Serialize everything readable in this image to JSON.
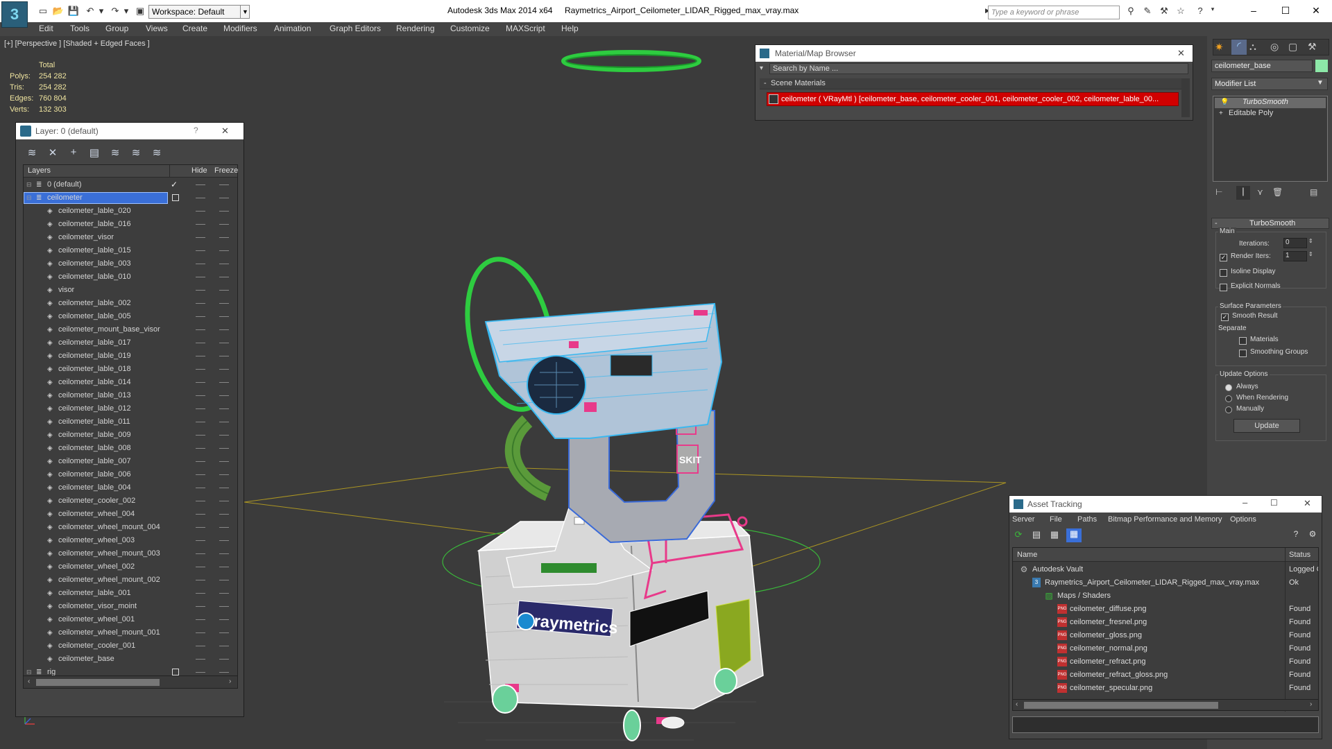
{
  "app": {
    "title": "Autodesk 3ds Max  2014 x64",
    "file": "Raymetrics_Airport_Ceilometer_LIDAR_Rigged_max_vray.max",
    "workspace": "Workspace: Default",
    "search_placeholder": "Type a keyword or phrase",
    "logo": "3"
  },
  "menu": [
    "Edit",
    "Tools",
    "Group",
    "Views",
    "Create",
    "Modifiers",
    "Animation",
    "Graph Editors",
    "Rendering",
    "Customize",
    "MAXScript",
    "Help"
  ],
  "viewport": {
    "label": "[+] [Perspective ] [Shaded + Edged Faces ]",
    "stats": {
      "header": "Total",
      "rows": [
        {
          "label": "Polys:",
          "value": "254 282"
        },
        {
          "label": "Tris:",
          "value": "254 282"
        },
        {
          "label": "Edges:",
          "value": "760 804"
        },
        {
          "label": "Verts:",
          "value": "132 303"
        }
      ]
    },
    "logo_text": "raymetrics",
    "label_sticker": "SKIT"
  },
  "layer_explorer": {
    "title": "Layer: 0 (default)",
    "help": "?",
    "close": "✕",
    "columns": {
      "layers": "Layers",
      "hide": "Hide",
      "freeze": "Freeze"
    },
    "rows": [
      {
        "name": "0 (default)",
        "level": 0,
        "check": "✓"
      },
      {
        "name": "ceilometer",
        "level": 0,
        "selected": true
      },
      {
        "name": "ceilometer_lable_020",
        "level": 1
      },
      {
        "name": "ceilometer_lable_016",
        "level": 1
      },
      {
        "name": "ceilometer_visor",
        "level": 1
      },
      {
        "name": "ceilometer_lable_015",
        "level": 1
      },
      {
        "name": "ceilometer_lable_003",
        "level": 1
      },
      {
        "name": "ceilometer_lable_010",
        "level": 1
      },
      {
        "name": "visor",
        "level": 1
      },
      {
        "name": "ceilometer_lable_002",
        "level": 1
      },
      {
        "name": "ceilometer_lable_005",
        "level": 1
      },
      {
        "name": "ceilometer_mount_base_visor",
        "level": 1
      },
      {
        "name": "ceilometer_lable_017",
        "level": 1
      },
      {
        "name": "ceilometer_lable_019",
        "level": 1
      },
      {
        "name": "ceilometer_lable_018",
        "level": 1
      },
      {
        "name": "ceilometer_lable_014",
        "level": 1
      },
      {
        "name": "ceilometer_lable_013",
        "level": 1
      },
      {
        "name": "ceilometer_lable_012",
        "level": 1
      },
      {
        "name": "ceilometer_lable_011",
        "level": 1
      },
      {
        "name": "ceilometer_lable_009",
        "level": 1
      },
      {
        "name": "ceilometer_lable_008",
        "level": 1
      },
      {
        "name": "ceilometer_lable_007",
        "level": 1
      },
      {
        "name": "ceilometer_lable_006",
        "level": 1
      },
      {
        "name": "ceilometer_lable_004",
        "level": 1
      },
      {
        "name": "ceilometer_cooler_002",
        "level": 1
      },
      {
        "name": "ceilometer_wheel_004",
        "level": 1
      },
      {
        "name": "ceilometer_wheel_mount_004",
        "level": 1
      },
      {
        "name": "ceilometer_wheel_003",
        "level": 1
      },
      {
        "name": "ceilometer_wheel_mount_003",
        "level": 1
      },
      {
        "name": "ceilometer_wheel_002",
        "level": 1
      },
      {
        "name": "ceilometer_wheel_mount_002",
        "level": 1
      },
      {
        "name": "ceilometer_lable_001",
        "level": 1
      },
      {
        "name": "ceilometer_visor_moint",
        "level": 1
      },
      {
        "name": "ceilometer_wheel_001",
        "level": 1
      },
      {
        "name": "ceilometer_wheel_mount_001",
        "level": 1
      },
      {
        "name": "ceilometer_cooler_001",
        "level": 1
      },
      {
        "name": "ceilometer_base",
        "level": 1
      },
      {
        "name": "rig",
        "level": 0
      }
    ]
  },
  "material_browser": {
    "title": "Material/Map Browser",
    "close": "✕",
    "search_placeholder": "Search by Name ...",
    "section": "Scene Materials",
    "section_toggle": "-",
    "item": "ceilometer  ( VRayMtl )  [ceilometer_base, ceilometer_cooler_001, ceilometer_cooler_002, ceilometer_lable_00..."
  },
  "command_panel": {
    "object_name": "ceilometer_base",
    "modifier_list": "Modifier List",
    "stack": [
      "TurboSmooth",
      "Editable Poly"
    ],
    "rollout_title": "TurboSmooth",
    "rollout_toggle": "-",
    "main_group": "Main",
    "iterations_label": "Iterations:",
    "iterations_value": "0",
    "render_iters_label": "Render Iters:",
    "render_iters_value": "1",
    "isoline_display": "Isoline Display",
    "explicit_normals": "Explicit Normals",
    "surface_params": "Surface Parameters",
    "smooth_result": "Smooth Result",
    "separate": "Separate",
    "materials": "Materials",
    "smoothing_groups": "Smoothing Groups",
    "update_options": "Update Options",
    "always": "Always",
    "when_rendering": "When Rendering",
    "manually": "Manually",
    "update_button": "Update",
    "check_mark": "✓"
  },
  "asset_tracking": {
    "title": "Asset Tracking",
    "menu": [
      "Server",
      "File",
      "Paths",
      "Bitmap Performance and Memory",
      "Options"
    ],
    "columns": {
      "name": "Name",
      "status": "Status"
    },
    "rows": [
      {
        "name": "Autodesk Vault",
        "status": "Logged C",
        "level": 0,
        "icon": "vault"
      },
      {
        "name": "Raymetrics_Airport_Ceilometer_LIDAR_Rigged_max_vray.max",
        "status": "Ok",
        "level": 1,
        "icon": "max"
      },
      {
        "name": "Maps / Shaders",
        "status": "",
        "level": 2,
        "icon": "maps"
      },
      {
        "name": "ceilometer_diffuse.png",
        "status": "Found",
        "level": 3,
        "icon": "png"
      },
      {
        "name": "ceilometer_fresnel.png",
        "status": "Found",
        "level": 3,
        "icon": "png"
      },
      {
        "name": "ceilometer_gloss.png",
        "status": "Found",
        "level": 3,
        "icon": "png"
      },
      {
        "name": "ceilometer_normal.png",
        "status": "Found",
        "level": 3,
        "icon": "png"
      },
      {
        "name": "ceilometer_refract.png",
        "status": "Found",
        "level": 3,
        "icon": "png"
      },
      {
        "name": "ceilometer_refract_gloss.png",
        "status": "Found",
        "level": 3,
        "icon": "png"
      },
      {
        "name": "ceilometer_specular.png",
        "status": "Found",
        "level": 3,
        "icon": "png"
      }
    ]
  },
  "colors": {
    "selection_blue": "#3a6fd8",
    "wire_green": "#2ecc40",
    "wire_cyan": "#3ab8f0",
    "wire_pink": "#e83a8a",
    "material_red": "#d00000",
    "stats_yellow": "#f0e5a0"
  }
}
